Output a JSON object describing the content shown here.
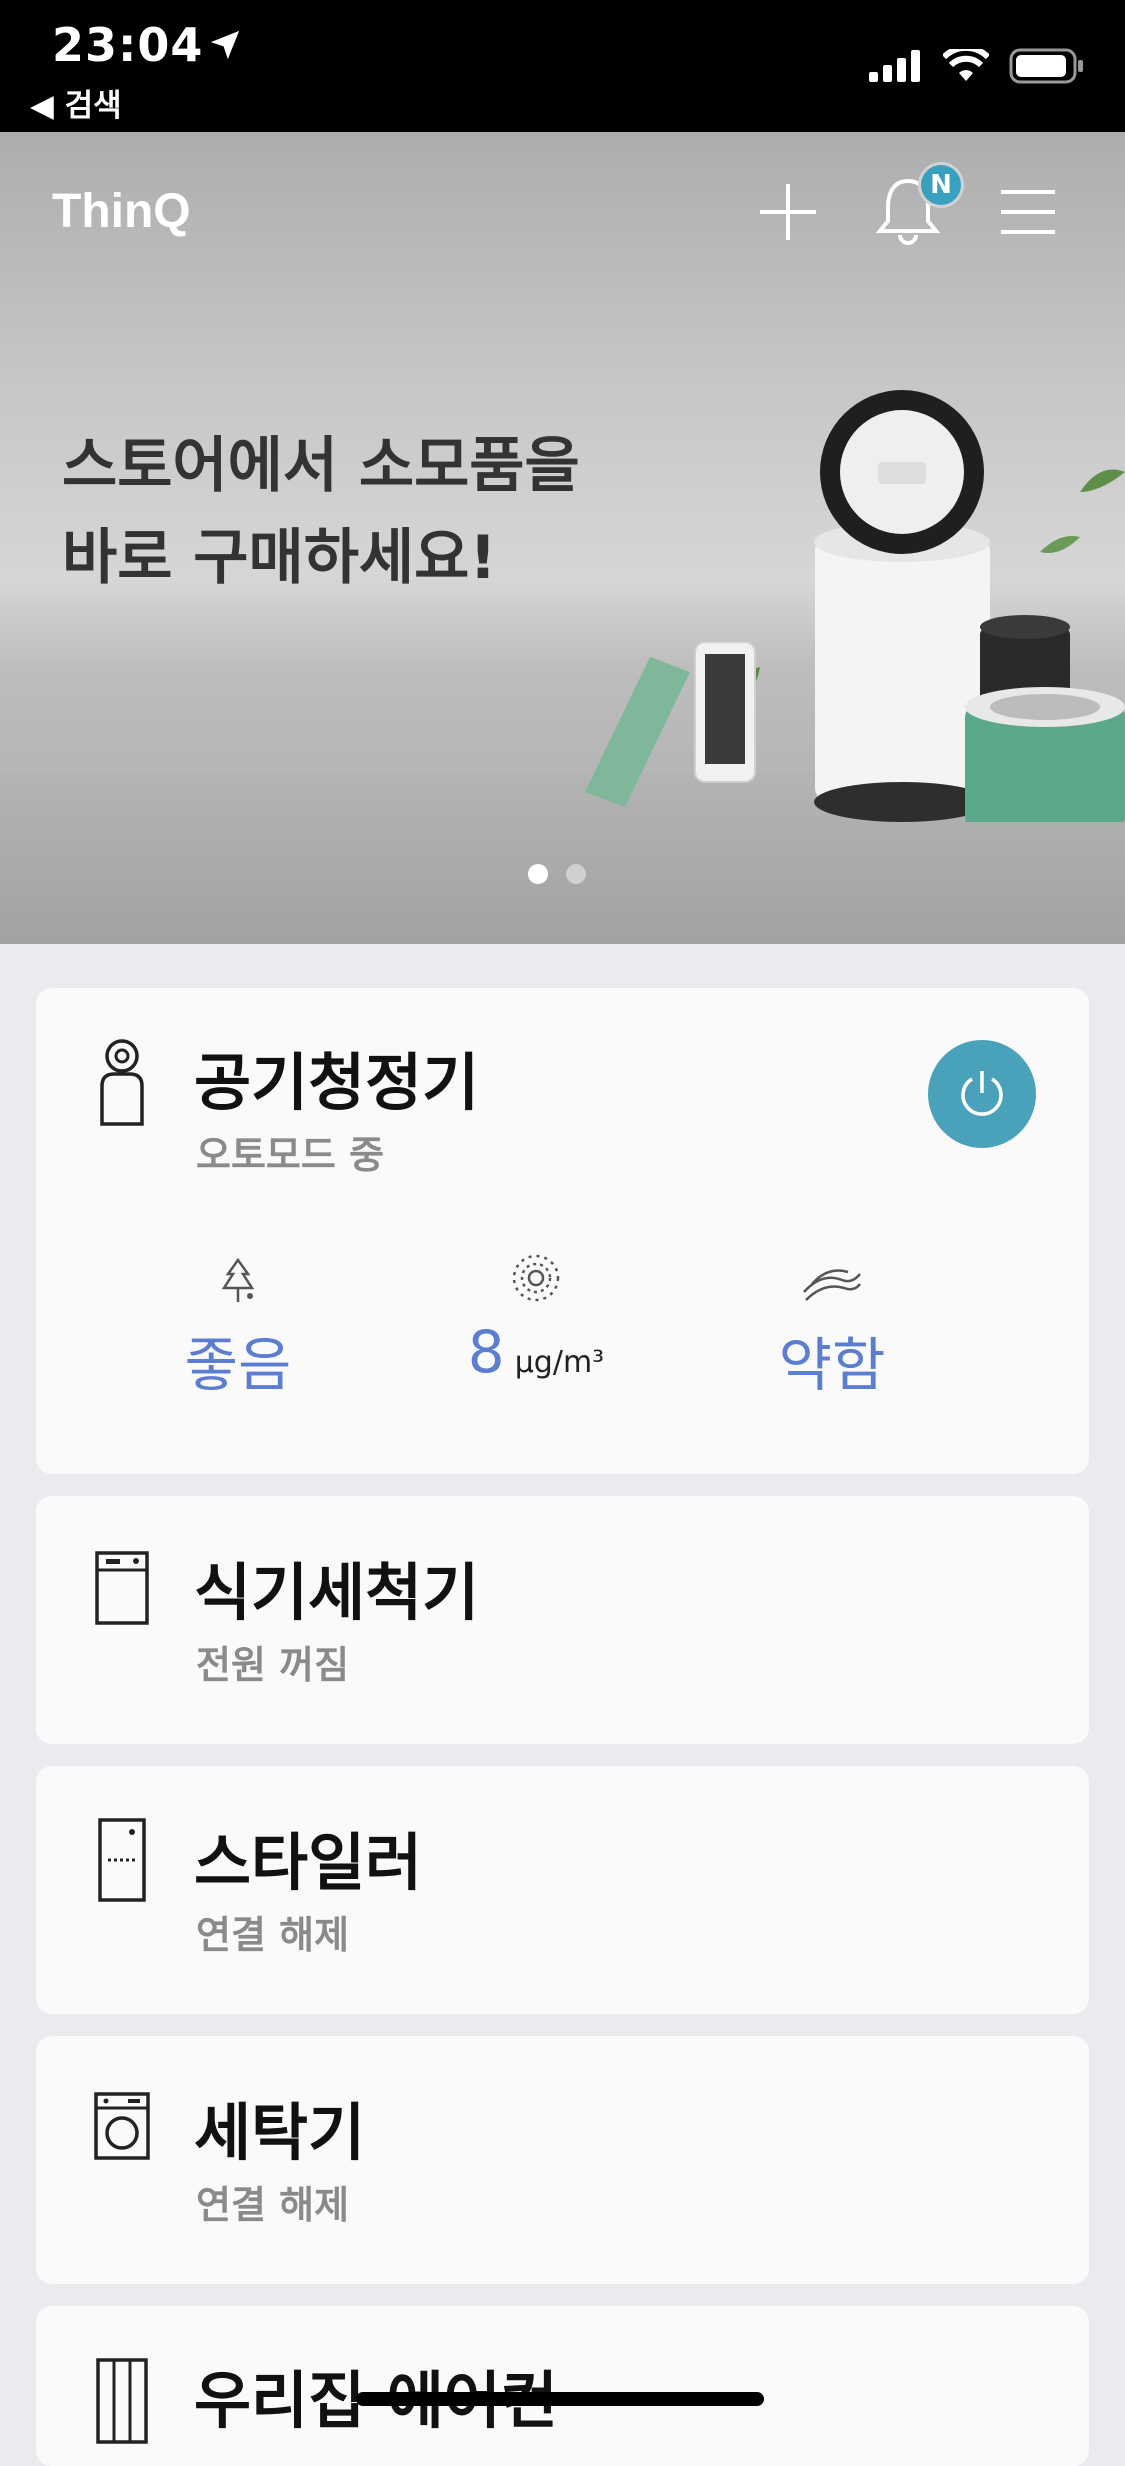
{
  "status_bar": {
    "time": "23:04",
    "back_label": "◀ 검색"
  },
  "header": {
    "logo": "ThinQ",
    "notification_badge": "N"
  },
  "banner": {
    "headline_line1": "스토어에서 소모품을",
    "headline_line2": "바로 구매하세요!",
    "page_count": 2,
    "active_page": 1
  },
  "devices": [
    {
      "name": "공기청정기",
      "status": "오토모드 중",
      "icon": "air-purifier-icon",
      "metrics": [
        {
          "icon": "tree-icon",
          "value": "좋음",
          "unit": ""
        },
        {
          "icon": "dust-icon",
          "value": "8",
          "unit": "μg/m³"
        },
        {
          "icon": "wind-icon",
          "value": "약함",
          "unit": ""
        }
      ]
    },
    {
      "name": "식기세척기",
      "status": "전원 꺼짐",
      "icon": "dishwasher-icon"
    },
    {
      "name": "스타일러",
      "status": "연결 해제",
      "icon": "styler-icon"
    },
    {
      "name": "세탁기",
      "status": "연결 해제",
      "icon": "washer-icon"
    },
    {
      "name": "우리집 에어컨",
      "status": "",
      "icon": "air-conditioner-icon"
    }
  ],
  "colors": {
    "accent": "#4aa2ba",
    "metric": "#5c7ed1",
    "badge": "#3aa0bf"
  }
}
